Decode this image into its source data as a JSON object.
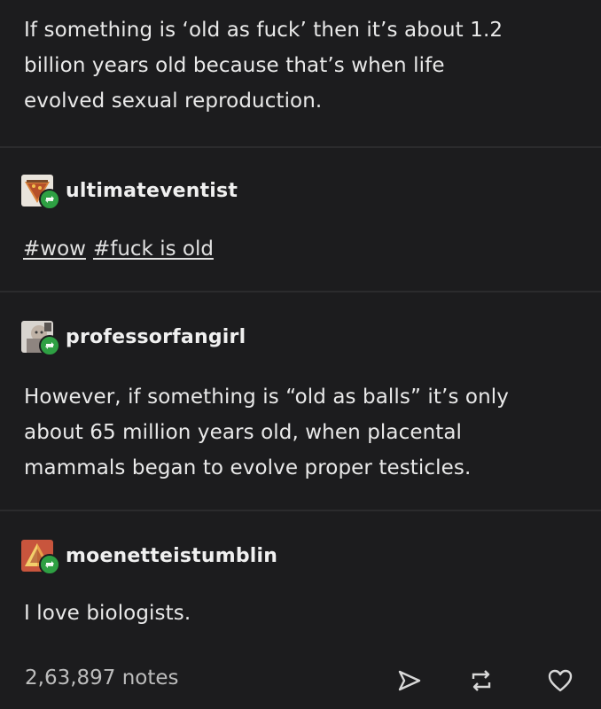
{
  "original_post": {
    "lines": [
      "If something is ‘old as fuck’ then it’s about 1.2",
      "billion years old because that’s when life",
      "evolved sexual reproduction."
    ]
  },
  "reblogs": [
    {
      "username": "ultimateventist",
      "avatar_icon": "avatar-ultimateventist-icon",
      "tags": [
        "#wow",
        "#fuck is old"
      ]
    },
    {
      "username": "professorfangirl",
      "avatar_icon": "avatar-professorfangirl-icon",
      "lines": [
        "However, if something is “old as balls” it’s only",
        "about 65 million years old, when placental",
        "mammals began to evolve proper testicles."
      ]
    },
    {
      "username": "moenetteistumblin",
      "avatar_icon": "avatar-moenetteistumblin-icon",
      "lines": [
        "I love biologists."
      ]
    }
  ],
  "footer": {
    "notes": "2,63,897 notes",
    "icons": [
      "send-icon",
      "reblog-icon",
      "heart-icon"
    ]
  },
  "colors": {
    "background": "#1c1c1e",
    "text": "#e9e9e9",
    "badge": "#2ea043"
  }
}
